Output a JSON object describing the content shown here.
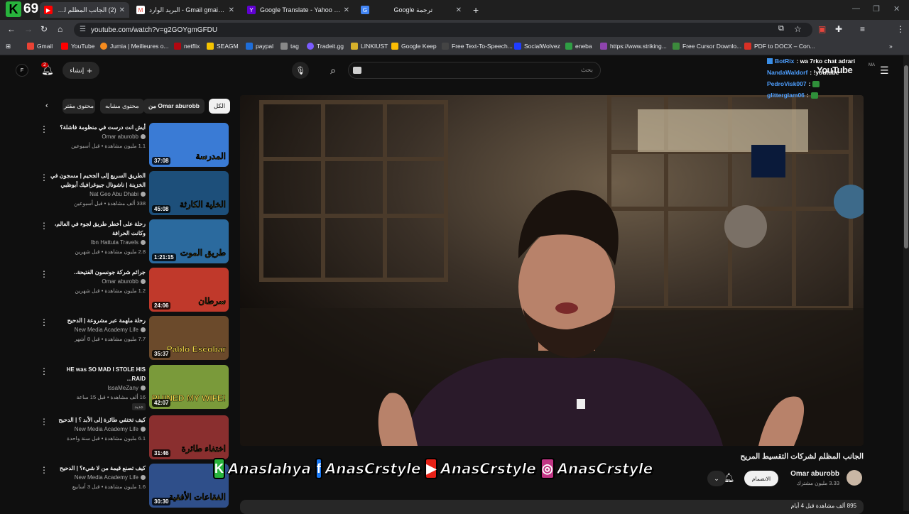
{
  "browser": {
    "counter_badge": {
      "letter": "K",
      "number": "69"
    },
    "tabs": [
      {
        "title": "(2) الجانب المظلم لشركات",
        "active": true
      },
      {
        "title": "البريد الوارد - Gmail ‏gmail.com@",
        "active": false
      },
      {
        "title": "Google Translate - Yahoo Search",
        "active": false
      },
      {
        "title": "Google ترجمة",
        "active": false
      }
    ],
    "new_tab_label": "+",
    "url": "youtube.com/watch?v=g2GOYgmGFDU",
    "bookmarks": [
      "Gmail",
      "YouTube",
      "Jumia | Meilleures o...",
      "netflix",
      "SEAGM",
      "paypal",
      "tag",
      "Tradeit.gg",
      "LINKIUST",
      "Google Keep",
      "Free Text-To-Speech...",
      "SocialWolvez",
      "eneba",
      "https://www.striking...",
      "Free Cursor Downlo...",
      "PDF to DOCX – Con..."
    ]
  },
  "youtube": {
    "avatar_letter": "F",
    "notifications_count": "2",
    "create_label": "إنشاء",
    "search_placeholder": "بحث",
    "logo_text": "YouTube",
    "logo_suffix": "MA",
    "chips": [
      "الكل",
      "من Omar aburobb",
      "محتوى مشابه",
      "محتوى مقتر"
    ],
    "related": [
      {
        "title": "أيش انت درست في منظومة فاشلة؟",
        "channel": "Omar aburobb",
        "meta": "1.1 مليون مشاهدة • قبل أسبوعين",
        "duration": "37:08",
        "thumb_text": "المدرسة",
        "thumb_bg": "#3a7bd5"
      },
      {
        "title": "الطريق السريع إلى الجحيم | مسجون في الخزينة | ناشونال جيوغرافيك أبوظبي",
        "channel": "Nat Geo Abu Dhabi",
        "meta": "338 ألف مشاهدة • قبل أسبوعين",
        "duration": "45:08",
        "thumb_text": "الخلية الكارثة",
        "thumb_bg": "#1d4f7a"
      },
      {
        "title": "رحلة على أخطر طريق لجوء في العالم، وكانت الحرافة",
        "channel": "Ibn Hattuta Travels",
        "meta": "2.8 مليون مشاهدة • قبل شهرين",
        "duration": "1:21:15",
        "thumb_text": "طريق الموت",
        "thumb_bg": "#2b6a9e"
      },
      {
        "title": "جرائم شركة جونسون الفتيحة..",
        "channel": "Omar aburobb",
        "meta": "1.2 مليون مشاهدة • قبل شهرين",
        "duration": "24:06",
        "thumb_text": "سرطان",
        "thumb_bg": "#c0392b"
      },
      {
        "title": "رحلة ملهمة عبر مشروعة | الدحيح",
        "channel": "New Media Academy Life",
        "meta": "7.7 مليون مشاهدة • قبل 8 أشهر",
        "duration": "35:37",
        "thumb_text": "Pablo Escobar",
        "thumb_bg": "#6b4a2b"
      },
      {
        "title": "HE was SO MAD I STOLE HIS RAID...",
        "channel": "IssaMeZany",
        "meta": "16 ألف مشاهدة • قبل 15 ساعة",
        "duration": "42:07",
        "thumb_text": "YOU RUINED MY WIFE!",
        "thumb_bg": "#7a9a3a",
        "badge": "جديد"
      },
      {
        "title": "كيف تختفي طائرة إلى الأبد ؟ | الدحيح",
        "channel": "New Media Academy Life",
        "meta": "6.1 مليون مشاهدة • قبل سنة واحدة",
        "duration": "31:46",
        "thumb_text": "اختفاء طائرة",
        "thumb_bg": "#8a2f2f"
      },
      {
        "title": "كيف تصنع قيمة من لا شيء؟ | الدحيح",
        "channel": "New Media Academy Life",
        "meta": "1.6 مليون مشاهدة • قبل 3 أسابيع",
        "duration": "30:30",
        "thumb_text": "الفقاعات الأفقية",
        "thumb_bg": "#2f4f8a"
      }
    ],
    "chat": [
      {
        "user": "BotRix",
        "message": ": wa 7rko chat adrari"
      },
      {
        "user": "NandaWaldorf",
        "message": ": !youtube"
      },
      {
        "user": "PedroVisk007",
        "message": ":"
      },
      {
        "user": "glitterglam06",
        "message": ":"
      }
    ],
    "video": {
      "title": "الجانب المظلم لشركات التقسيط المريح",
      "channel": "Omar aburobb",
      "subscribers": "3.33 مليون مشترك",
      "join_label": "الانضمام",
      "views_partial": "895 ألف مشاهدة قبل 4 أيام"
    },
    "stream_banner": [
      {
        "icon": "K",
        "icon_color": "#28b43c",
        "text": "AnasIahya"
      },
      {
        "icon": "f",
        "icon_color": "#1877f2",
        "text": "AnasCrstyle"
      },
      {
        "icon": "▶",
        "icon_color": "#e62117",
        "text": "AnasCrstyle"
      },
      {
        "icon": "◎",
        "icon_color": "#c13584",
        "text": "AnasCrstyle"
      }
    ]
  }
}
